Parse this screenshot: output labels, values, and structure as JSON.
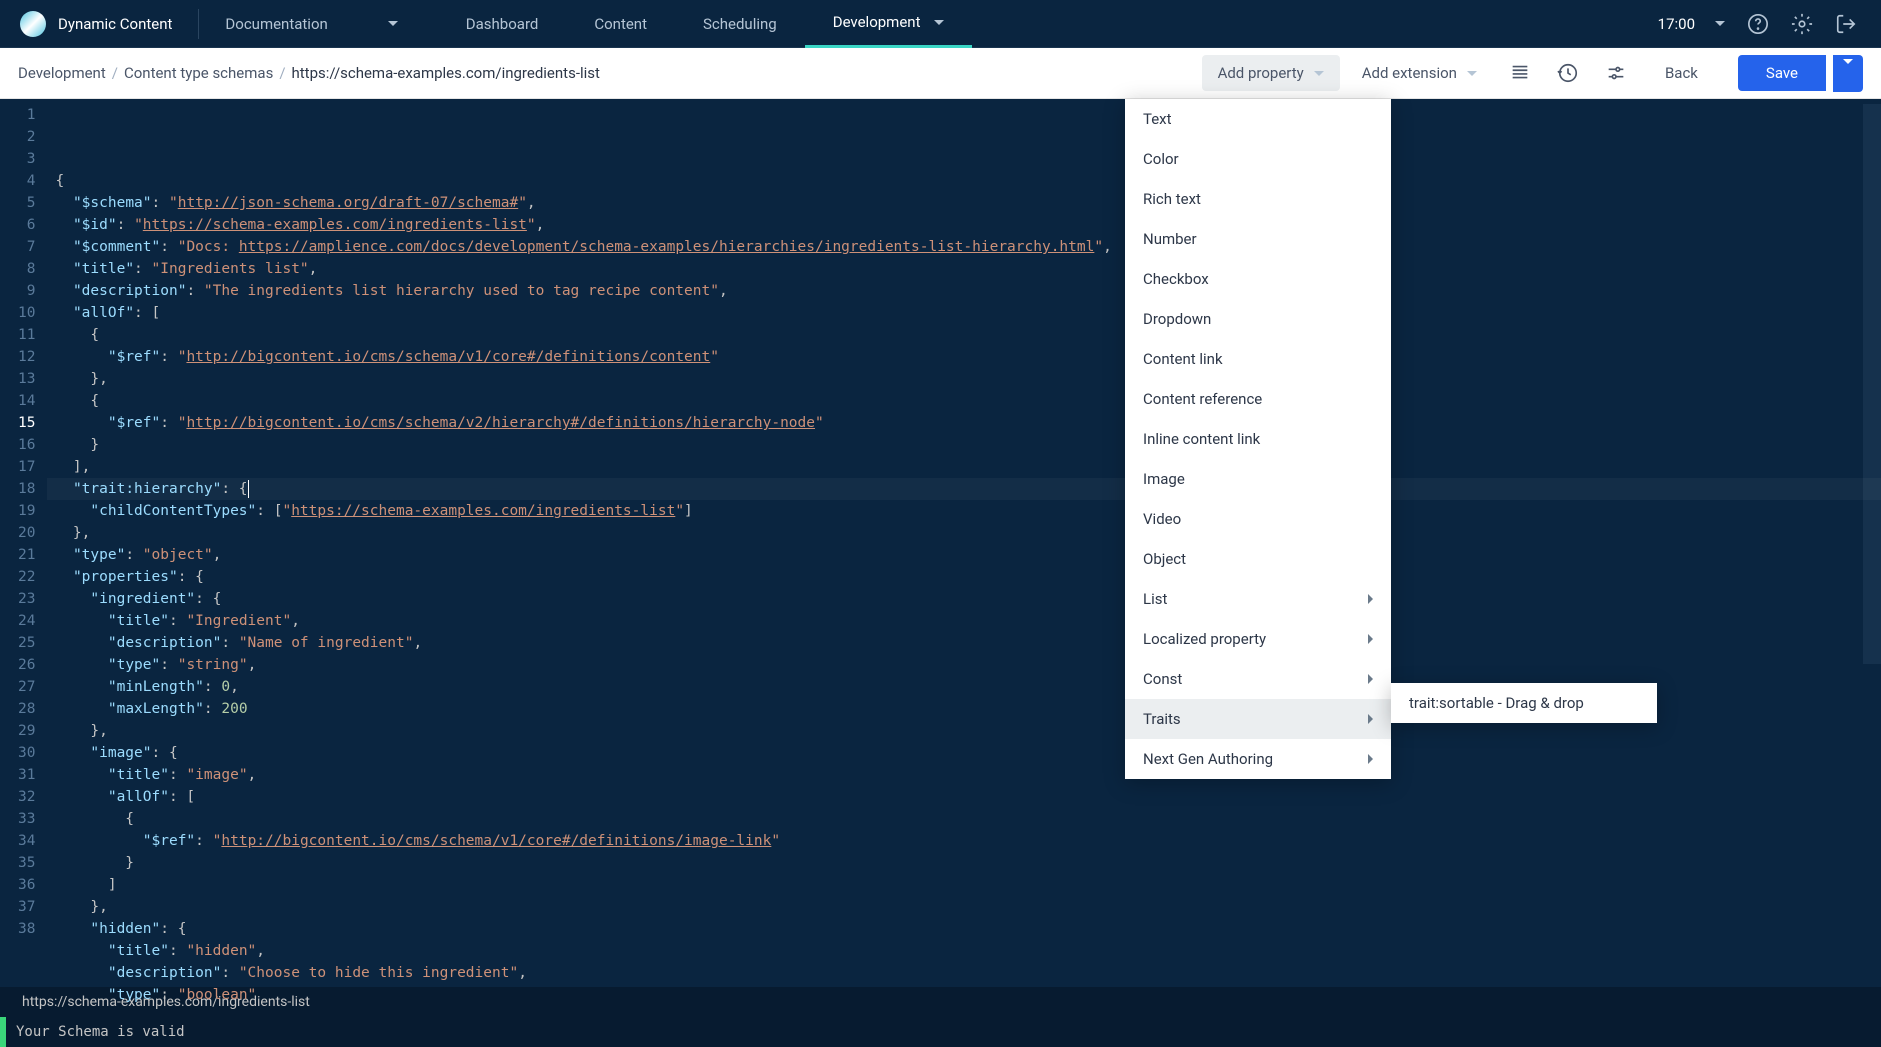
{
  "app_name": "Dynamic Content",
  "top_dropdown": "Documentation",
  "nav": [
    "Dashboard",
    "Content",
    "Scheduling",
    "Development"
  ],
  "nav_active_index": 3,
  "time": "17:00",
  "breadcrumbs": [
    "Development",
    "Content type schemas",
    "https://schema-examples.com/ingredients-list"
  ],
  "toolbar": {
    "add_property": "Add property",
    "add_extension": "Add extension",
    "back": "Back",
    "save": "Save"
  },
  "dropdown_items": [
    {
      "label": "Text",
      "submenu": false
    },
    {
      "label": "Color",
      "submenu": false
    },
    {
      "label": "Rich text",
      "submenu": false
    },
    {
      "label": "Number",
      "submenu": false
    },
    {
      "label": "Checkbox",
      "submenu": false
    },
    {
      "label": "Dropdown",
      "submenu": false
    },
    {
      "label": "Content link",
      "submenu": false
    },
    {
      "label": "Content reference",
      "submenu": false
    },
    {
      "label": "Inline content link",
      "submenu": false
    },
    {
      "label": "Image",
      "submenu": false
    },
    {
      "label": "Video",
      "submenu": false
    },
    {
      "label": "Object",
      "submenu": false
    },
    {
      "label": "List",
      "submenu": true
    },
    {
      "label": "Localized property",
      "submenu": true
    },
    {
      "label": "Const",
      "submenu": true
    },
    {
      "label": "Traits",
      "submenu": true,
      "highlighted": true
    },
    {
      "label": "Next Gen Authoring",
      "submenu": true
    }
  ],
  "submenu_items": [
    "trait:sortable - Drag & drop"
  ],
  "active_line": 15,
  "code_lines": [
    [
      {
        "t": "p",
        "v": "{"
      }
    ],
    [
      {
        "t": "p",
        "v": "  "
      },
      {
        "t": "k",
        "v": "\"$schema\""
      },
      {
        "t": "p",
        "v": ": "
      },
      {
        "t": "s",
        "v": "\""
      },
      {
        "t": "sl",
        "v": "http://json-schema.org/draft-07/schema#"
      },
      {
        "t": "s",
        "v": "\""
      },
      {
        "t": "p",
        "v": ","
      }
    ],
    [
      {
        "t": "p",
        "v": "  "
      },
      {
        "t": "k",
        "v": "\"$id\""
      },
      {
        "t": "p",
        "v": ": "
      },
      {
        "t": "s",
        "v": "\""
      },
      {
        "t": "sl",
        "v": "https://schema-examples.com/ingredients-list"
      },
      {
        "t": "s",
        "v": "\""
      },
      {
        "t": "p",
        "v": ","
      }
    ],
    [
      {
        "t": "p",
        "v": "  "
      },
      {
        "t": "k",
        "v": "\"$comment\""
      },
      {
        "t": "p",
        "v": ": "
      },
      {
        "t": "s",
        "v": "\"Docs: "
      },
      {
        "t": "sl",
        "v": "https://amplience.com/docs/development/schema-examples/hierarchies/ingredients-list-hierarchy.html"
      },
      {
        "t": "s",
        "v": "\""
      },
      {
        "t": "p",
        "v": ","
      }
    ],
    [
      {
        "t": "p",
        "v": "  "
      },
      {
        "t": "k",
        "v": "\"title\""
      },
      {
        "t": "p",
        "v": ": "
      },
      {
        "t": "s",
        "v": "\"Ingredients list\""
      },
      {
        "t": "p",
        "v": ","
      }
    ],
    [
      {
        "t": "p",
        "v": "  "
      },
      {
        "t": "k",
        "v": "\"description\""
      },
      {
        "t": "p",
        "v": ": "
      },
      {
        "t": "s",
        "v": "\"The ingredients list hierarchy used to tag recipe content\""
      },
      {
        "t": "p",
        "v": ","
      }
    ],
    [
      {
        "t": "p",
        "v": "  "
      },
      {
        "t": "k",
        "v": "\"allOf\""
      },
      {
        "t": "p",
        "v": ": ["
      }
    ],
    [
      {
        "t": "p",
        "v": "    {"
      }
    ],
    [
      {
        "t": "p",
        "v": "      "
      },
      {
        "t": "k",
        "v": "\"$ref\""
      },
      {
        "t": "p",
        "v": ": "
      },
      {
        "t": "s",
        "v": "\""
      },
      {
        "t": "sl",
        "v": "http://bigcontent.io/cms/schema/v1/core#/definitions/content"
      },
      {
        "t": "s",
        "v": "\""
      }
    ],
    [
      {
        "t": "p",
        "v": "    },"
      }
    ],
    [
      {
        "t": "p",
        "v": "    {"
      }
    ],
    [
      {
        "t": "p",
        "v": "      "
      },
      {
        "t": "k",
        "v": "\"$ref\""
      },
      {
        "t": "p",
        "v": ": "
      },
      {
        "t": "s",
        "v": "\""
      },
      {
        "t": "sl",
        "v": "http://bigcontent.io/cms/schema/v2/hierarchy#/definitions/hierarchy-node"
      },
      {
        "t": "s",
        "v": "\""
      }
    ],
    [
      {
        "t": "p",
        "v": "    }"
      }
    ],
    [
      {
        "t": "p",
        "v": "  ],"
      }
    ],
    [
      {
        "t": "p",
        "v": "  "
      },
      {
        "t": "k",
        "v": "\"trait:hierarchy\""
      },
      {
        "t": "p",
        "v": ": {"
      }
    ],
    [
      {
        "t": "p",
        "v": "    "
      },
      {
        "t": "k",
        "v": "\"childContentTypes\""
      },
      {
        "t": "p",
        "v": ": ["
      },
      {
        "t": "s",
        "v": "\""
      },
      {
        "t": "sl",
        "v": "https://schema-examples.com/ingredients-list"
      },
      {
        "t": "s",
        "v": "\""
      },
      {
        "t": "p",
        "v": "]"
      }
    ],
    [
      {
        "t": "p",
        "v": "  },"
      }
    ],
    [
      {
        "t": "p",
        "v": "  "
      },
      {
        "t": "k",
        "v": "\"type\""
      },
      {
        "t": "p",
        "v": ": "
      },
      {
        "t": "s",
        "v": "\"object\""
      },
      {
        "t": "p",
        "v": ","
      }
    ],
    [
      {
        "t": "p",
        "v": "  "
      },
      {
        "t": "k",
        "v": "\"properties\""
      },
      {
        "t": "p",
        "v": ": {"
      }
    ],
    [
      {
        "t": "p",
        "v": "    "
      },
      {
        "t": "k",
        "v": "\"ingredient\""
      },
      {
        "t": "p",
        "v": ": {"
      }
    ],
    [
      {
        "t": "p",
        "v": "      "
      },
      {
        "t": "k",
        "v": "\"title\""
      },
      {
        "t": "p",
        "v": ": "
      },
      {
        "t": "s",
        "v": "\"Ingredient\""
      },
      {
        "t": "p",
        "v": ","
      }
    ],
    [
      {
        "t": "p",
        "v": "      "
      },
      {
        "t": "k",
        "v": "\"description\""
      },
      {
        "t": "p",
        "v": ": "
      },
      {
        "t": "s",
        "v": "\"Name of ingredient\""
      },
      {
        "t": "p",
        "v": ","
      }
    ],
    [
      {
        "t": "p",
        "v": "      "
      },
      {
        "t": "k",
        "v": "\"type\""
      },
      {
        "t": "p",
        "v": ": "
      },
      {
        "t": "s",
        "v": "\"string\""
      },
      {
        "t": "p",
        "v": ","
      }
    ],
    [
      {
        "t": "p",
        "v": "      "
      },
      {
        "t": "k",
        "v": "\"minLength\""
      },
      {
        "t": "p",
        "v": ": "
      },
      {
        "t": "n",
        "v": "0"
      },
      {
        "t": "p",
        "v": ","
      }
    ],
    [
      {
        "t": "p",
        "v": "      "
      },
      {
        "t": "k",
        "v": "\"maxLength\""
      },
      {
        "t": "p",
        "v": ": "
      },
      {
        "t": "n",
        "v": "200"
      }
    ],
    [
      {
        "t": "p",
        "v": "    },"
      }
    ],
    [
      {
        "t": "p",
        "v": "    "
      },
      {
        "t": "k",
        "v": "\"image\""
      },
      {
        "t": "p",
        "v": ": {"
      }
    ],
    [
      {
        "t": "p",
        "v": "      "
      },
      {
        "t": "k",
        "v": "\"title\""
      },
      {
        "t": "p",
        "v": ": "
      },
      {
        "t": "s",
        "v": "\"image\""
      },
      {
        "t": "p",
        "v": ","
      }
    ],
    [
      {
        "t": "p",
        "v": "      "
      },
      {
        "t": "k",
        "v": "\"allOf\""
      },
      {
        "t": "p",
        "v": ": ["
      }
    ],
    [
      {
        "t": "p",
        "v": "        {"
      }
    ],
    [
      {
        "t": "p",
        "v": "          "
      },
      {
        "t": "k",
        "v": "\"$ref\""
      },
      {
        "t": "p",
        "v": ": "
      },
      {
        "t": "s",
        "v": "\""
      },
      {
        "t": "sl",
        "v": "http://bigcontent.io/cms/schema/v1/core#/definitions/image-link"
      },
      {
        "t": "s",
        "v": "\""
      }
    ],
    [
      {
        "t": "p",
        "v": "        }"
      }
    ],
    [
      {
        "t": "p",
        "v": "      ]"
      }
    ],
    [
      {
        "t": "p",
        "v": "    },"
      }
    ],
    [
      {
        "t": "p",
        "v": "    "
      },
      {
        "t": "k",
        "v": "\"hidden\""
      },
      {
        "t": "p",
        "v": ": {"
      }
    ],
    [
      {
        "t": "p",
        "v": "      "
      },
      {
        "t": "k",
        "v": "\"title\""
      },
      {
        "t": "p",
        "v": ": "
      },
      {
        "t": "s",
        "v": "\"hidden\""
      },
      {
        "t": "p",
        "v": ","
      }
    ],
    [
      {
        "t": "p",
        "v": "      "
      },
      {
        "t": "k",
        "v": "\"description\""
      },
      {
        "t": "p",
        "v": ": "
      },
      {
        "t": "s",
        "v": "\"Choose to hide this ingredient\""
      },
      {
        "t": "p",
        "v": ","
      }
    ],
    [
      {
        "t": "p",
        "v": "      "
      },
      {
        "t": "k",
        "v": "\"type\""
      },
      {
        "t": "p",
        "v": ": "
      },
      {
        "t": "s",
        "v": "\"boolean\""
      }
    ]
  ],
  "tab_label": "https://schema-examples.com/ingredients-list",
  "status_text": "Your Schema is valid"
}
